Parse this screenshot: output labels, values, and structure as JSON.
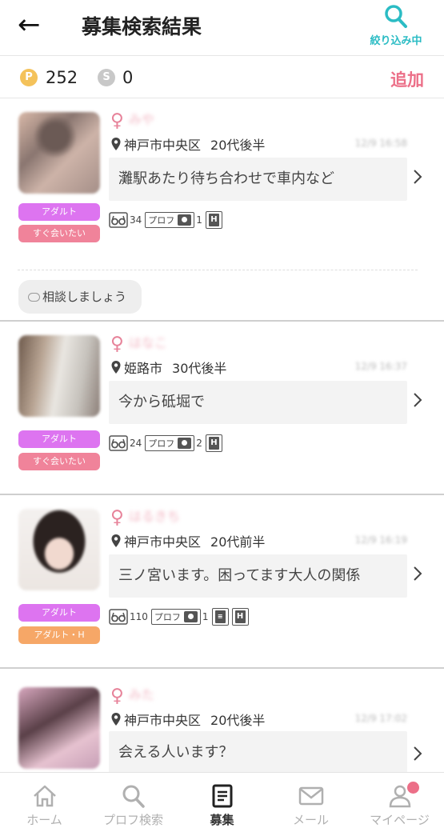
{
  "header": {
    "back_icon": "←",
    "title": "募集検索結果",
    "filter_label": "絞り込み中"
  },
  "points": {
    "p_icon": "P",
    "p_value": "252",
    "s_icon": "S",
    "s_value": "0",
    "add_label": "追加"
  },
  "posts": [
    {
      "gender": "♀",
      "name": "みや",
      "location": "神戸市中央区",
      "age": "20代後半",
      "time": "12/9 16:58",
      "message": "灘駅あたり待ち合わせで車内など",
      "tags": [
        "アダルト",
        "すぐ会いたい"
      ],
      "views": "34",
      "prof_label": "プロフ",
      "photos": "1",
      "consult": "相談しましょう"
    },
    {
      "gender": "♀",
      "name": "はなこ",
      "location": "姫路市",
      "age": "30代後半",
      "time": "12/9 16:37",
      "message": "今から砥堀で",
      "tags": [
        "アダルト",
        "すぐ会いたい"
      ],
      "views": "24",
      "prof_label": "プロフ",
      "photos": "2"
    },
    {
      "gender": "♀",
      "name": "はるきち",
      "location": "神戸市中央区",
      "age": "20代前半",
      "time": "12/9 16:19",
      "message": "三ノ宮います。困ってます大人の関係",
      "tags": [
        "アダルト",
        "アダルト・H"
      ],
      "views": "110",
      "prof_label": "プロフ",
      "photos": "1"
    },
    {
      "gender": "♀",
      "name": "みた",
      "location": "神戸市中央区",
      "age": "20代後半",
      "time": "12/9 17:02",
      "message": "会える人います？"
    }
  ],
  "nav": {
    "home": "ホーム",
    "prof_search": "プロフ検索",
    "recruit": "募集",
    "mail": "メール",
    "mypage": "マイページ"
  },
  "colors": {
    "accent_pink": "#ec6f88",
    "teal": "#2bbcc4",
    "tag_purple": "#dd74f0",
    "tag_pink": "#f0839a",
    "tag_orange": "#f6a767"
  }
}
